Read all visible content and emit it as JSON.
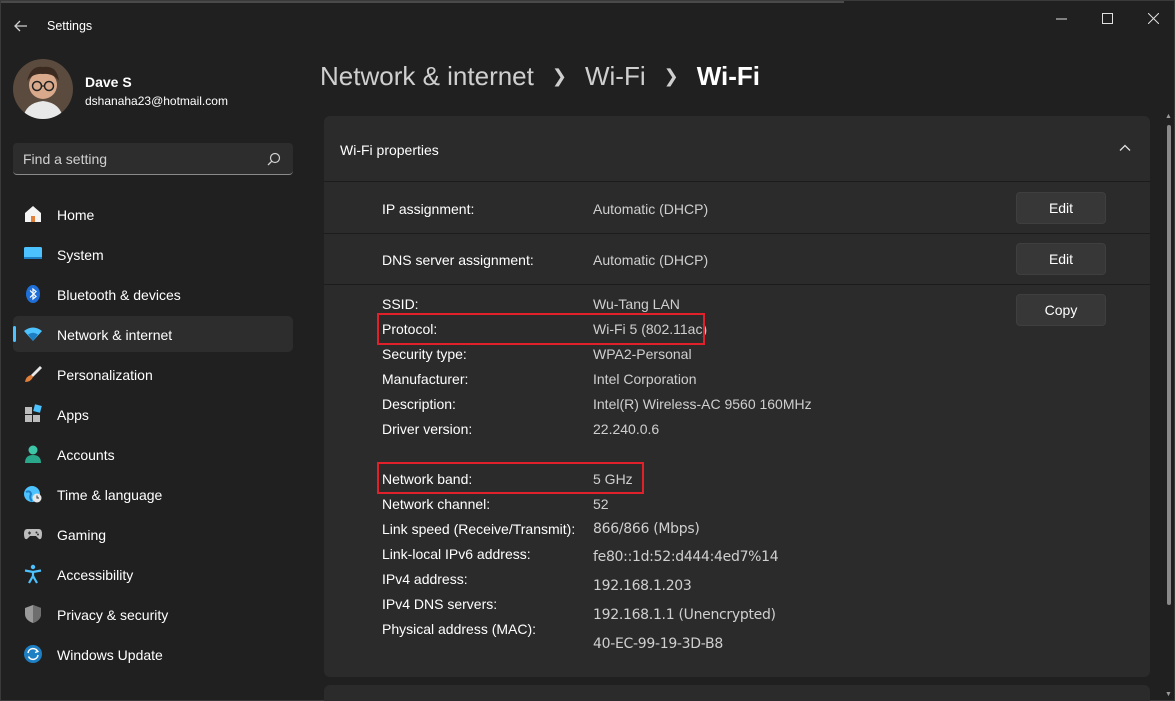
{
  "window": {
    "title": "Settings"
  },
  "user": {
    "name": "Dave S",
    "email": "dshanaha23@hotmail.com"
  },
  "search": {
    "placeholder": "Find a setting"
  },
  "nav": [
    {
      "label": "Home",
      "icon": "home-icon",
      "active": false
    },
    {
      "label": "System",
      "icon": "system-icon",
      "active": false
    },
    {
      "label": "Bluetooth & devices",
      "icon": "bluetooth-icon",
      "active": false
    },
    {
      "label": "Network & internet",
      "icon": "wifi-icon",
      "active": true
    },
    {
      "label": "Personalization",
      "icon": "brush-icon",
      "active": false
    },
    {
      "label": "Apps",
      "icon": "apps-icon",
      "active": false
    },
    {
      "label": "Accounts",
      "icon": "accounts-icon",
      "active": false
    },
    {
      "label": "Time & language",
      "icon": "globe-icon",
      "active": false
    },
    {
      "label": "Gaming",
      "icon": "controller-icon",
      "active": false
    },
    {
      "label": "Accessibility",
      "icon": "accessibility-icon",
      "active": false
    },
    {
      "label": "Privacy & security",
      "icon": "shield-icon",
      "active": false
    },
    {
      "label": "Windows Update",
      "icon": "update-icon",
      "active": false
    }
  ],
  "breadcrumb": {
    "part1": "Network & internet",
    "part2": "Wi-Fi",
    "current": "Wi-Fi"
  },
  "card": {
    "title": "Wi-Fi properties",
    "ip": {
      "label": "IP assignment:",
      "value": "Automatic (DHCP)",
      "button": "Edit"
    },
    "dns": {
      "label": "DNS server assignment:",
      "value": "Automatic (DHCP)",
      "button": "Edit"
    },
    "copy_button": "Copy",
    "props": [
      {
        "label": "SSID:",
        "value": "Wu-Tang LAN"
      },
      {
        "label": "Protocol:",
        "value": "Wi-Fi 5 (802.11ac)"
      },
      {
        "label": "Security type:",
        "value": "WPA2-Personal"
      },
      {
        "label": "Manufacturer:",
        "value": "Intel Corporation"
      },
      {
        "label": "Description:",
        "value": "Intel(R) Wireless-AC 9560 160MHz"
      },
      {
        "label": "Driver version:",
        "value": "22.240.0.6"
      },
      {
        "label": "Network band:",
        "value": "5 GHz"
      },
      {
        "label": "Network channel:",
        "value": "52"
      },
      {
        "label": "Link speed (Receive/Transmit):",
        "value": "866/866 (Mbps)"
      },
      {
        "label": "Link-local IPv6 address:",
        "value": "fe80::1d:52:d444:4ed7%14"
      },
      {
        "label": "IPv4 address:",
        "value": "192.168.1.203"
      },
      {
        "label": "IPv4 DNS servers:",
        "value": "192.168.1.1 (Unencrypted)"
      },
      {
        "label": "Physical address (MAC):",
        "value": "40-EC-99-19-3D-B8"
      }
    ]
  },
  "colors": {
    "accent": "#4cc2ff",
    "highlight": "#e0202a",
    "background": "#202020",
    "card": "#2b2b2b"
  }
}
